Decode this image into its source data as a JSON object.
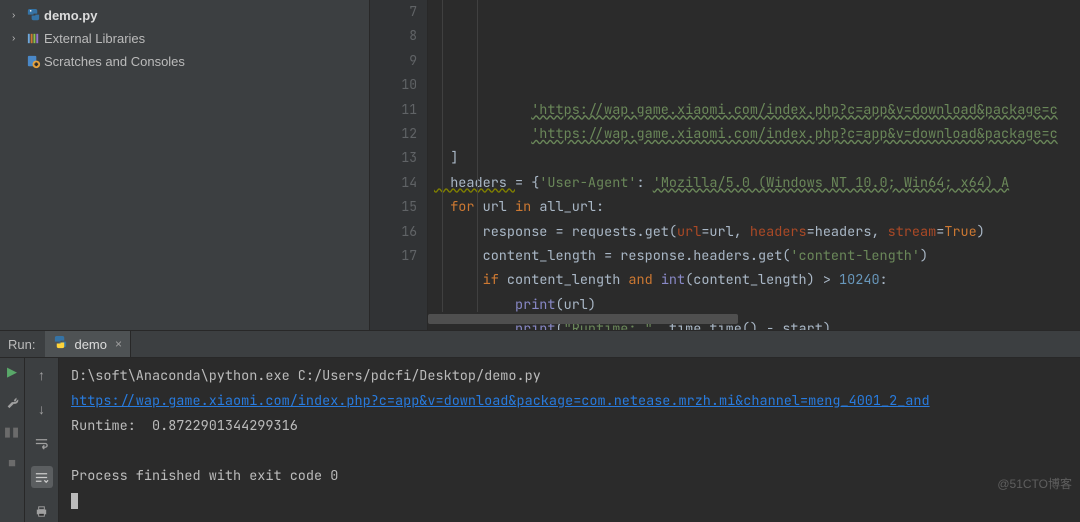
{
  "project": {
    "items": [
      {
        "name": "demo.py",
        "icon": "python-file",
        "bold": true,
        "expandable": true,
        "indent": 0
      },
      {
        "name": "External Libraries",
        "icon": "libraries",
        "bold": false,
        "expandable": true,
        "indent": 0
      },
      {
        "name": "Scratches and Consoles",
        "icon": "scratches",
        "bold": false,
        "expandable": false,
        "indent": 0
      }
    ]
  },
  "editor": {
    "gutter_start": 7,
    "gutter_end": 17,
    "fold_marks": {
      "9": "⌐",
      "11": "┌",
      "14": "├",
      "16": "└"
    },
    "lines": [
      [
        {
          "t": "            ",
          "c": "c-default"
        },
        {
          "t": "'https://wap.game.xiaomi.com/index.php?c=app&v=download&package=c",
          "c": "c-url"
        }
      ],
      [
        {
          "t": "            ",
          "c": "c-default"
        },
        {
          "t": "'https://wap.game.xiaomi.com/index.php?c=app&v=download&package=c",
          "c": "c-url"
        }
      ],
      [
        {
          "t": "  ]",
          "c": "c-default"
        }
      ],
      [
        {
          "t": "  headers ",
          "c": "c-warn"
        },
        {
          "t": "= {",
          "c": "c-default"
        },
        {
          "t": "'User-Agent'",
          "c": "c-str"
        },
        {
          "t": ": ",
          "c": "c-default"
        },
        {
          "t": "'Mozilla/5.0 (Windows NT 10.0; Win64; x64) A",
          "c": "c-url"
        }
      ],
      [
        {
          "t": "  ",
          "c": "c-default"
        },
        {
          "t": "for ",
          "c": "c-kw"
        },
        {
          "t": "url ",
          "c": "c-default"
        },
        {
          "t": "in ",
          "c": "c-kw"
        },
        {
          "t": "all_url:",
          "c": "c-default"
        }
      ],
      [
        {
          "t": "      response = requests.get(",
          "c": "c-default"
        },
        {
          "t": "url",
          "c": "c-param"
        },
        {
          "t": "=url, ",
          "c": "c-default"
        },
        {
          "t": "headers",
          "c": "c-param"
        },
        {
          "t": "=headers, ",
          "c": "c-default"
        },
        {
          "t": "stream",
          "c": "c-param"
        },
        {
          "t": "=",
          "c": "c-default"
        },
        {
          "t": "True",
          "c": "c-kw"
        },
        {
          "t": ")",
          "c": "c-default"
        }
      ],
      [
        {
          "t": "      content_length = response.headers.get(",
          "c": "c-default"
        },
        {
          "t": "'content-length'",
          "c": "c-str"
        },
        {
          "t": ")",
          "c": "c-default"
        }
      ],
      [
        {
          "t": "      ",
          "c": "c-default"
        },
        {
          "t": "if ",
          "c": "c-kw"
        },
        {
          "t": "content_length ",
          "c": "c-default"
        },
        {
          "t": "and ",
          "c": "c-kw"
        },
        {
          "t": "int",
          "c": "c-builtin"
        },
        {
          "t": "(content_length) > ",
          "c": "c-default"
        },
        {
          "t": "10240",
          "c": "c-num"
        },
        {
          "t": ":",
          "c": "c-default"
        }
      ],
      [
        {
          "t": "          ",
          "c": "c-default"
        },
        {
          "t": "print",
          "c": "c-builtin"
        },
        {
          "t": "(url)",
          "c": "c-default"
        }
      ],
      [
        {
          "t": "          ",
          "c": "c-default"
        },
        {
          "t": "print",
          "c": "c-builtin"
        },
        {
          "t": "(",
          "c": "c-default"
        },
        {
          "t": "\"Runtime: \"",
          "c": "c-str"
        },
        {
          "t": ", time.time() - start)",
          "c": "c-default"
        }
      ],
      [
        {
          "t": "",
          "c": "c-default"
        }
      ]
    ]
  },
  "run": {
    "label": "Run:",
    "tab": {
      "name": "demo",
      "icon": "python"
    },
    "toolbar_left": [
      "run",
      "wrench",
      "pause",
      "square"
    ],
    "toolbar_nav": [
      "up",
      "down",
      "sep",
      "wrap",
      "print"
    ],
    "console_lines": [
      {
        "text": "D:\\soft\\Anaconda\\python.exe C:/Users/pdcfi/Desktop/demo.py",
        "class": ""
      },
      {
        "text": "https://wap.game.xiaomi.com/index.php?c=app&v=download&package=com.netease.mrzh.mi&channel=meng_4001_2_and",
        "class": "link"
      },
      {
        "text": "Runtime:  0.8722901344299316",
        "class": ""
      },
      {
        "text": "",
        "class": ""
      },
      {
        "text": "Process finished with exit code 0",
        "class": ""
      }
    ]
  },
  "watermark": "@51CTO博客"
}
